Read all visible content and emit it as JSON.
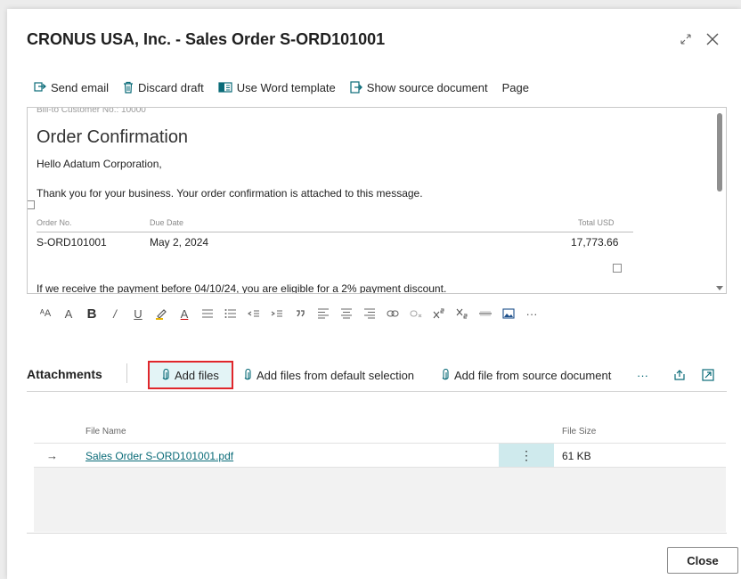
{
  "dialog": {
    "title": "CRONUS USA, Inc. - Sales Order S-ORD101001"
  },
  "toolbar": {
    "send_email": "Send email",
    "discard_draft": "Discard draft",
    "use_word_template": "Use Word template",
    "show_source_document": "Show source document",
    "page": "Page"
  },
  "editor": {
    "cut_off_line": "Bill-to Customer No.: 10000",
    "heading": "Order Confirmation",
    "greeting": "Hello Adatum Corporation,",
    "thanks": "Thank you for your business. Your order confirmation is attached to this message.",
    "order_no_label": "Order No.",
    "due_date_label": "Due Date",
    "total_label": "Total USD",
    "order_no_value": "S-ORD101001",
    "due_date_value": "May 2, 2024",
    "total_value": "17,773.66",
    "payment_note": "If we receive the payment before 04/10/24, you are eligible for a 2% payment discount."
  },
  "format_toolbar": {
    "font_size": "ᴬA",
    "font_grow": "A",
    "bold": "B",
    "italic": "/",
    "underline": "U",
    "font_color": "A",
    "more": "···"
  },
  "attachments": {
    "title": "Attachments",
    "add_files": "Add files",
    "add_default": "Add files from default selection",
    "add_source": "Add file from source document",
    "more": "···",
    "columns": {
      "file_name": "File Name",
      "file_size": "File Size"
    },
    "rows": [
      {
        "file_name": "Sales Order S-ORD101001.pdf",
        "file_size": "61 KB"
      }
    ]
  },
  "footer": {
    "close": "Close"
  },
  "colors": {
    "accent": "#0a6b78",
    "highlight_border": "#e0262b",
    "selected_bg": "#e3f4f6"
  }
}
